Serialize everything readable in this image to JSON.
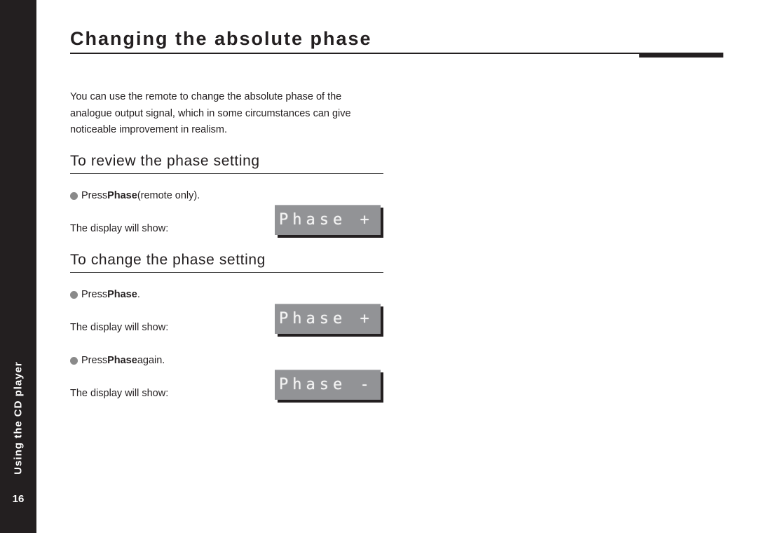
{
  "sidebar": {
    "section_label": "Using the CD player",
    "page_number": "16"
  },
  "page": {
    "title": "Changing the absolute phase",
    "intro": "You can use the remote to change the absolute phase of the analogue output signal, which in some circumstances can give noticeable improvement in realism."
  },
  "sections": [
    {
      "heading": "To review the phase setting",
      "steps": [
        {
          "bullet_icon": "grey-circle-bullet",
          "prefix": "Press ",
          "key": "Phase",
          "suffix": " (remote only).",
          "display_label": "The display will show:",
          "display_text": "Phase +"
        }
      ]
    },
    {
      "heading": "To change the phase setting",
      "steps": [
        {
          "bullet_icon": "grey-circle-bullet",
          "prefix": "Press ",
          "key": "Phase",
          "suffix": ".",
          "display_label": "The display will show:",
          "display_text": "Phase +"
        },
        {
          "bullet_icon": "grey-circle-bullet",
          "prefix": "Press ",
          "key": "Phase",
          "suffix": " again.",
          "display_label": "The display will show:",
          "display_text": "Phase -"
        }
      ]
    }
  ],
  "colors": {
    "ink": "#231f20",
    "lcd_background": "#929396",
    "lcd_text": "#f4f4f4",
    "bullet": "#8a8a8a"
  }
}
